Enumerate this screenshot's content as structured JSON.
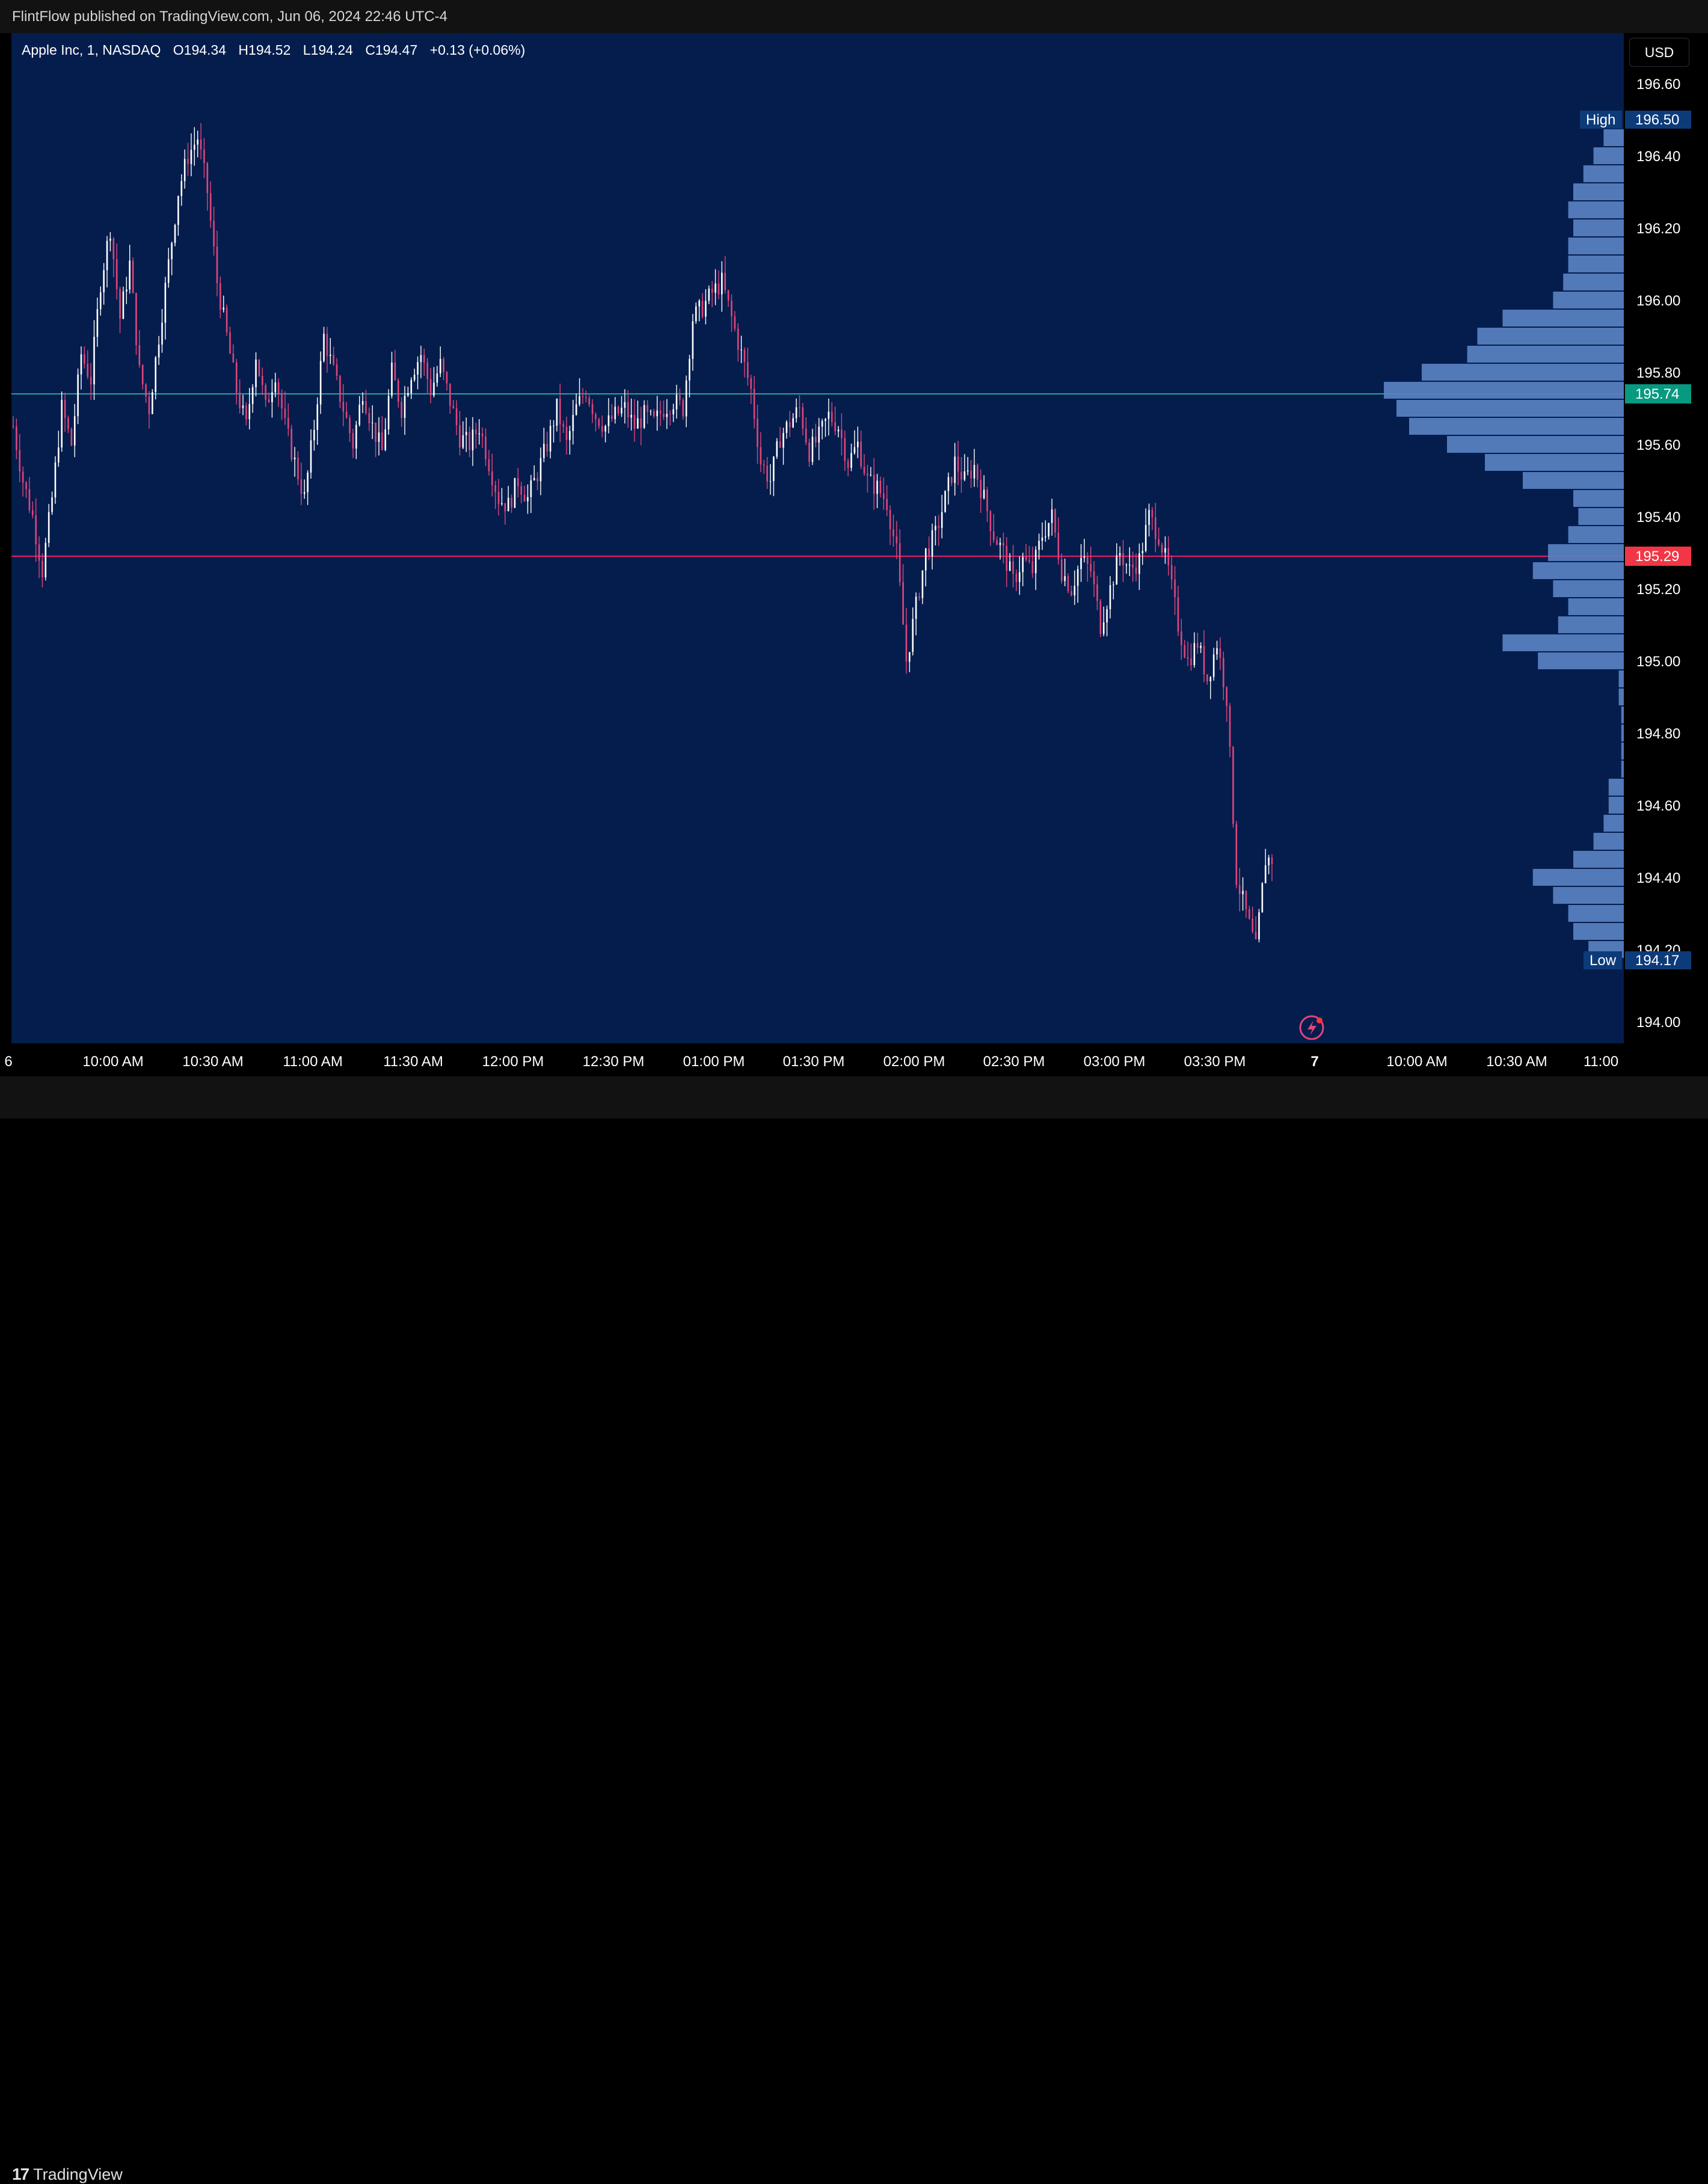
{
  "header": {
    "publish_line": "FlintFlow published on TradingView.com, Jun 06, 2024 22:46 UTC-4"
  },
  "legend": {
    "symbol": "Apple Inc, 1, NASDAQ",
    "open": "O194.34",
    "high": "H194.52",
    "low": "L194.24",
    "close": "C194.47",
    "change": "+0.13 (+0.06%)"
  },
  "price_scale": {
    "currency": "USD",
    "ticks": [
      "196.60",
      "196.40",
      "196.20",
      "196.00",
      "195.80",
      "195.60",
      "195.40",
      "195.20",
      "195.00",
      "194.80",
      "194.60",
      "194.40",
      "194.20",
      "194.00"
    ],
    "high_label": "High",
    "high_value": "196.50",
    "low_label": "Low",
    "low_value": "194.17",
    "line1_value": "195.74",
    "line2_value": "195.29"
  },
  "time_axis": {
    "labels": [
      "10:00 AM",
      "10:30 AM",
      "11:00 AM",
      "11:30 AM",
      "12:00 PM",
      "12:30 PM",
      "01:00 PM",
      "01:30 PM",
      "02:00 PM",
      "02:30 PM",
      "03:00 PM",
      "03:30 PM",
      "7",
      "10:00 AM",
      "10:30 AM",
      "11:00"
    ],
    "edge_label": "6"
  },
  "brand": {
    "name": "TradingView"
  },
  "colors": {
    "background": "#051d4d",
    "candle_up": "#ffffff",
    "candle_down": "#e0457b",
    "line_teal": "#26a69a",
    "line_magenta": "#e91e63",
    "label_green": "#089981",
    "label_red": "#f23645",
    "volume_profile": "#5b84c4",
    "high_low_label": "#0d3b7a"
  },
  "chart_data": {
    "type": "candlestick",
    "symbol": "Apple Inc",
    "interval": "1",
    "exchange": "NASDAQ",
    "date": "2024-06-06",
    "ylim": [
      193.94,
      196.74
    ],
    "horizontal_lines": [
      195.74,
      195.29
    ],
    "session_high": 196.5,
    "session_low": 194.17,
    "x_ticks": [
      "10:00 AM",
      "10:30 AM",
      "11:00 AM",
      "11:30 AM",
      "12:00 PM",
      "12:30 PM",
      "01:00 PM",
      "01:30 PM",
      "02:00 PM",
      "02:30 PM",
      "03:00 PM",
      "03:30 PM",
      "7",
      "10:00 AM",
      "10:30 AM",
      "11:00"
    ],
    "close_path": [
      {
        "t": "09:30",
        "p": 195.65
      },
      {
        "t": "09:33",
        "p": 195.5
      },
      {
        "t": "09:36",
        "p": 195.4
      },
      {
        "t": "09:39",
        "p": 195.25
      },
      {
        "t": "09:42",
        "p": 195.45
      },
      {
        "t": "09:45",
        "p": 195.7
      },
      {
        "t": "09:48",
        "p": 195.6
      },
      {
        "t": "09:51",
        "p": 195.85
      },
      {
        "t": "09:54",
        "p": 195.78
      },
      {
        "t": "09:57",
        "p": 196.05
      },
      {
        "t": "10:00",
        "p": 196.2
      },
      {
        "t": "10:03",
        "p": 195.95
      },
      {
        "t": "10:06",
        "p": 196.1
      },
      {
        "t": "10:09",
        "p": 195.8
      },
      {
        "t": "10:12",
        "p": 195.7
      },
      {
        "t": "10:15",
        "p": 195.9
      },
      {
        "t": "10:18",
        "p": 196.1
      },
      {
        "t": "10:21",
        "p": 196.3
      },
      {
        "t": "10:24",
        "p": 196.4
      },
      {
        "t": "10:27",
        "p": 196.45
      },
      {
        "t": "10:30",
        "p": 196.3
      },
      {
        "t": "10:33",
        "p": 196.05
      },
      {
        "t": "10:36",
        "p": 195.9
      },
      {
        "t": "10:39",
        "p": 195.75
      },
      {
        "t": "10:42",
        "p": 195.65
      },
      {
        "t": "10:45",
        "p": 195.85
      },
      {
        "t": "10:48",
        "p": 195.7
      },
      {
        "t": "10:51",
        "p": 195.8
      },
      {
        "t": "10:54",
        "p": 195.65
      },
      {
        "t": "10:57",
        "p": 195.55
      },
      {
        "t": "11:00",
        "p": 195.45
      },
      {
        "t": "11:03",
        "p": 195.65
      },
      {
        "t": "11:06",
        "p": 195.9
      },
      {
        "t": "11:09",
        "p": 195.8
      },
      {
        "t": "11:12",
        "p": 195.7
      },
      {
        "t": "11:15",
        "p": 195.6
      },
      {
        "t": "11:18",
        "p": 195.75
      },
      {
        "t": "11:21",
        "p": 195.65
      },
      {
        "t": "11:24",
        "p": 195.58
      },
      {
        "t": "11:27",
        "p": 195.8
      },
      {
        "t": "11:30",
        "p": 195.7
      },
      {
        "t": "11:33",
        "p": 195.8
      },
      {
        "t": "11:36",
        "p": 195.85
      },
      {
        "t": "11:39",
        "p": 195.75
      },
      {
        "t": "11:42",
        "p": 195.82
      },
      {
        "t": "11:45",
        "p": 195.72
      },
      {
        "t": "11:48",
        "p": 195.62
      },
      {
        "t": "11:51",
        "p": 195.6
      },
      {
        "t": "11:54",
        "p": 195.65
      },
      {
        "t": "11:57",
        "p": 195.55
      },
      {
        "t": "12:00",
        "p": 195.45
      },
      {
        "t": "12:03",
        "p": 195.43
      },
      {
        "t": "12:06",
        "p": 195.5
      },
      {
        "t": "12:09",
        "p": 195.45
      },
      {
        "t": "12:12",
        "p": 195.52
      },
      {
        "t": "12:15",
        "p": 195.6
      },
      {
        "t": "12:18",
        "p": 195.7
      },
      {
        "t": "12:21",
        "p": 195.6
      },
      {
        "t": "12:24",
        "p": 195.7
      },
      {
        "t": "12:27",
        "p": 195.75
      },
      {
        "t": "12:30",
        "p": 195.68
      },
      {
        "t": "12:33",
        "p": 195.65
      },
      {
        "t": "12:36",
        "p": 195.68
      },
      {
        "t": "12:39",
        "p": 195.7
      },
      {
        "t": "12:42",
        "p": 195.65
      },
      {
        "t": "12:45",
        "p": 195.68
      },
      {
        "t": "12:48",
        "p": 195.66
      },
      {
        "t": "12:51",
        "p": 195.7
      },
      {
        "t": "12:54",
        "p": 195.72
      },
      {
        "t": "12:57",
        "p": 195.7
      },
      {
        "t": "13:00",
        "p": 195.95
      },
      {
        "t": "13:03",
        "p": 195.98
      },
      {
        "t": "13:06",
        "p": 196.02
      },
      {
        "t": "13:09",
        "p": 196.05
      },
      {
        "t": "13:12",
        "p": 195.95
      },
      {
        "t": "13:15",
        "p": 195.85
      },
      {
        "t": "13:18",
        "p": 195.75
      },
      {
        "t": "13:21",
        "p": 195.55
      },
      {
        "t": "13:24",
        "p": 195.5
      },
      {
        "t": "13:27",
        "p": 195.62
      },
      {
        "t": "13:30",
        "p": 195.66
      },
      {
        "t": "13:33",
        "p": 195.7
      },
      {
        "t": "13:36",
        "p": 195.58
      },
      {
        "t": "13:39",
        "p": 195.62
      },
      {
        "t": "13:42",
        "p": 195.68
      },
      {
        "t": "13:45",
        "p": 195.65
      },
      {
        "t": "13:48",
        "p": 195.55
      },
      {
        "t": "13:51",
        "p": 195.6
      },
      {
        "t": "13:54",
        "p": 195.5
      },
      {
        "t": "13:57",
        "p": 195.48
      },
      {
        "t": "14:00",
        "p": 195.44
      },
      {
        "t": "14:03",
        "p": 195.3
      },
      {
        "t": "14:06",
        "p": 195.0
      },
      {
        "t": "14:09",
        "p": 195.15
      },
      {
        "t": "14:12",
        "p": 195.3
      },
      {
        "t": "14:15",
        "p": 195.35
      },
      {
        "t": "14:18",
        "p": 195.45
      },
      {
        "t": "14:21",
        "p": 195.55
      },
      {
        "t": "14:24",
        "p": 195.5
      },
      {
        "t": "14:27",
        "p": 195.54
      },
      {
        "t": "14:30",
        "p": 195.45
      },
      {
        "t": "14:33",
        "p": 195.35
      },
      {
        "t": "14:36",
        "p": 195.3
      },
      {
        "t": "14:39",
        "p": 195.22
      },
      {
        "t": "14:42",
        "p": 195.28
      },
      {
        "t": "14:45",
        "p": 195.25
      },
      {
        "t": "14:48",
        "p": 195.35
      },
      {
        "t": "14:51",
        "p": 195.4
      },
      {
        "t": "14:54",
        "p": 195.25
      },
      {
        "t": "14:57",
        "p": 195.2
      },
      {
        "t": "15:00",
        "p": 195.28
      },
      {
        "t": "15:03",
        "p": 195.25
      },
      {
        "t": "15:06",
        "p": 195.1
      },
      {
        "t": "15:09",
        "p": 195.2
      },
      {
        "t": "15:12",
        "p": 195.3
      },
      {
        "t": "15:15",
        "p": 195.25
      },
      {
        "t": "15:18",
        "p": 195.28
      },
      {
        "t": "15:21",
        "p": 195.4
      },
      {
        "t": "15:24",
        "p": 195.35
      },
      {
        "t": "15:27",
        "p": 195.25
      },
      {
        "t": "15:30",
        "p": 195.1
      },
      {
        "t": "15:33",
        "p": 195.0
      },
      {
        "t": "15:36",
        "p": 195.05
      },
      {
        "t": "15:39",
        "p": 194.95
      },
      {
        "t": "15:42",
        "p": 195.05
      },
      {
        "t": "15:45",
        "p": 194.9
      },
      {
        "t": "15:48",
        "p": 194.4
      },
      {
        "t": "15:51",
        "p": 194.3
      },
      {
        "t": "15:54",
        "p": 194.2
      },
      {
        "t": "15:57",
        "p": 194.45
      }
    ],
    "volume_profile": [
      {
        "price": 196.45,
        "vol": 0.08
      },
      {
        "price": 196.4,
        "vol": 0.12
      },
      {
        "price": 196.35,
        "vol": 0.16
      },
      {
        "price": 196.3,
        "vol": 0.2
      },
      {
        "price": 196.25,
        "vol": 0.22
      },
      {
        "price": 196.2,
        "vol": 0.2
      },
      {
        "price": 196.15,
        "vol": 0.22
      },
      {
        "price": 196.1,
        "vol": 0.22
      },
      {
        "price": 196.05,
        "vol": 0.24
      },
      {
        "price": 196.0,
        "vol": 0.28
      },
      {
        "price": 195.95,
        "vol": 0.48
      },
      {
        "price": 195.9,
        "vol": 0.58
      },
      {
        "price": 195.85,
        "vol": 0.62
      },
      {
        "price": 195.8,
        "vol": 0.8
      },
      {
        "price": 195.75,
        "vol": 0.95
      },
      {
        "price": 195.7,
        "vol": 0.9
      },
      {
        "price": 195.65,
        "vol": 0.85
      },
      {
        "price": 195.6,
        "vol": 0.7
      },
      {
        "price": 195.55,
        "vol": 0.55
      },
      {
        "price": 195.5,
        "vol": 0.4
      },
      {
        "price": 195.45,
        "vol": 0.2
      },
      {
        "price": 195.4,
        "vol": 0.18
      },
      {
        "price": 195.35,
        "vol": 0.22
      },
      {
        "price": 195.3,
        "vol": 0.3
      },
      {
        "price": 195.25,
        "vol": 0.36
      },
      {
        "price": 195.2,
        "vol": 0.28
      },
      {
        "price": 195.15,
        "vol": 0.22
      },
      {
        "price": 195.1,
        "vol": 0.26
      },
      {
        "price": 195.05,
        "vol": 0.48
      },
      {
        "price": 195.0,
        "vol": 0.34
      },
      {
        "price": 194.95,
        "vol": 0.02
      },
      {
        "price": 194.9,
        "vol": 0.02
      },
      {
        "price": 194.85,
        "vol": 0.01
      },
      {
        "price": 194.8,
        "vol": 0.01
      },
      {
        "price": 194.75,
        "vol": 0.01
      },
      {
        "price": 194.7,
        "vol": 0.01
      },
      {
        "price": 194.65,
        "vol": 0.06
      },
      {
        "price": 194.6,
        "vol": 0.06
      },
      {
        "price": 194.55,
        "vol": 0.08
      },
      {
        "price": 194.5,
        "vol": 0.12
      },
      {
        "price": 194.45,
        "vol": 0.2
      },
      {
        "price": 194.4,
        "vol": 0.36
      },
      {
        "price": 194.35,
        "vol": 0.28
      },
      {
        "price": 194.3,
        "vol": 0.22
      },
      {
        "price": 194.25,
        "vol": 0.2
      },
      {
        "price": 194.2,
        "vol": 0.14
      }
    ]
  }
}
